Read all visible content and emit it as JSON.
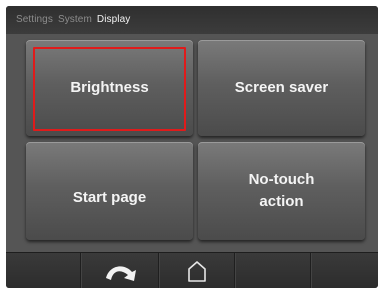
{
  "breadcrumb": {
    "items": [
      "Settings",
      "System",
      "Display"
    ]
  },
  "tiles": {
    "brightness": "Brightness",
    "screen_saver": "Screen saver",
    "start_page": "Start page",
    "no_touch_action_line1": "No-touch",
    "no_touch_action_line2": "action"
  },
  "selection": {
    "selected_tile": "Brightness",
    "highlight_color": "#e01b1b"
  },
  "navbar": {
    "back_icon": "back-arrow-icon",
    "home_icon": "home-icon"
  }
}
